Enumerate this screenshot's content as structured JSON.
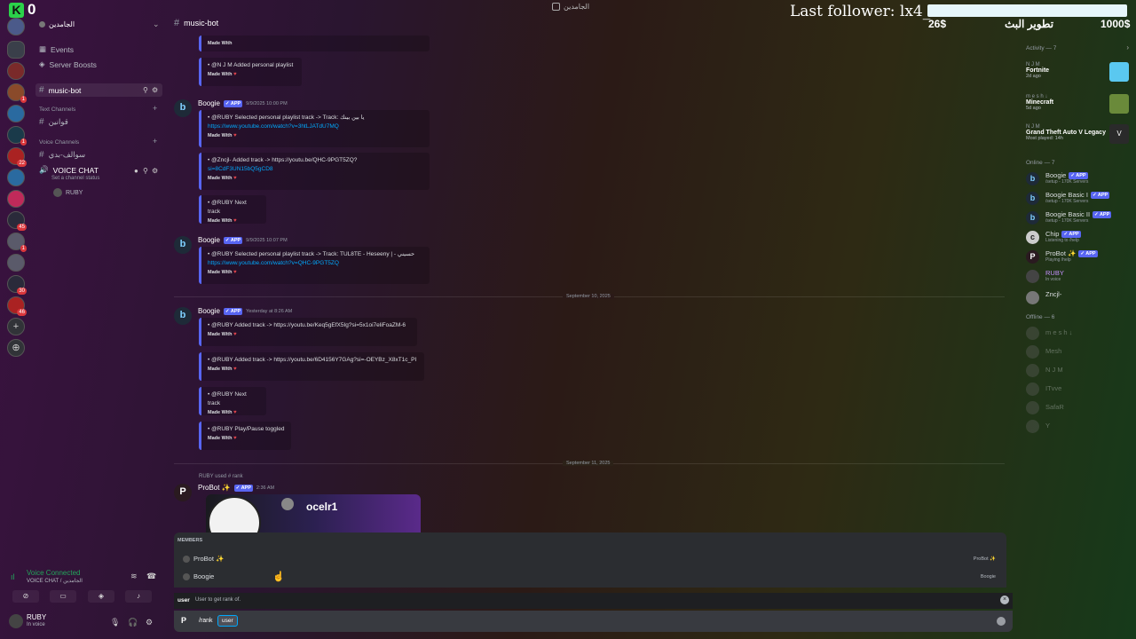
{
  "overlay": {
    "counter": "0",
    "window_title": "الجامدين",
    "last_follower": "Last follower: lx4_A",
    "goal_left": "26$",
    "goal_label": "تطوير البث",
    "goal_right": "1000$"
  },
  "server_rail": {
    "badges": [
      "1",
      "1",
      "22",
      "45",
      "1",
      "30",
      "1",
      "46"
    ]
  },
  "sidebar": {
    "guild_name": "الجامدين",
    "events": "Events",
    "server_boosts": "Server Boosts",
    "active_channel": "music-bot",
    "text_category": "Text Channels",
    "text_channel_1": "قوانين",
    "voice_category": "Voice Channels",
    "voice_channel_1": "سوالف-بدي",
    "voice_channel_2": "VOICE CHAT",
    "voice_status": "Set a channel status",
    "voice_member": "RUBY"
  },
  "voice_panel": {
    "connected": "Voice Connected",
    "sub": "VOICE CHAT / الجامدين",
    "user": "RUBY",
    "user_status": "In voice"
  },
  "chat": {
    "channel": "music-bot",
    "messages": {
      "e0_line": "Made With",
      "e1_line": "• @N J M Added personal playlist",
      "made_with": "Made With",
      "m1_author": "Boogie",
      "m1_ts": "9/9/2025 10:00 PM",
      "m1_e1_a": "• @RUBY Selected personal playlist track -> Track: يا بين بينك",
      "m1_e1_b": "https://www.youtube.com/watch?v=3htLJATdU7MQ",
      "m1_e2_a": "• @Zncjl- Added track -> https://youtu.be/QHC-9PGT5ZQ?",
      "m1_e2_b": "si=8CdF3UN15bQ5gCD8",
      "m1_e3": "• @RUBY Next track",
      "m2_author": "Boogie",
      "m2_ts": "9/9/2025 10:07 PM",
      "m2_e1_a": "• @RUBY Selected personal playlist track -> Track: TUL8TE - Heseeny | - حسيني",
      "m2_e1_b": "https://www.youtube.com/watch?v=QHC-9PGT5ZQ",
      "date1": "September 10, 2025",
      "m3_author": "Boogie",
      "m3_ts": "Yesterday at 8:26 AM",
      "m3_e1": "• @RUBY Added track -> https://youtu.be/Keq5gEfX5Ig?si=5x1oi7eliFoaZM-6",
      "m3_e2": "• @RUBY Added track -> https://youtu.be/6D4156Y7GAg?si=-OEYBz_X8xT1c_PI",
      "m3_e3": "• @RUBY Next track",
      "m3_e4": "• @RUBY Play/Pause toggled",
      "date2": "September 11, 2025",
      "m4_reply": "RUBY used # rank",
      "m4_author": "ProBot ✨",
      "m4_ts": "2:36 AM",
      "rank_name": "ocelr1"
    },
    "app_tag": "✓ APP"
  },
  "autocomplete": {
    "title": "MEMBERS",
    "items": [
      {
        "name": "ProBot ✨",
        "right": "ProBot ✨"
      },
      {
        "name": "Boogie",
        "right": "Boogie"
      }
    ],
    "option_key": "user",
    "option_desc": "User to get rank of.",
    "command": "/rank",
    "option_chip": "user"
  },
  "right_panel": {
    "activity_title": "Activity — 7",
    "activities": [
      {
        "who": "N J M",
        "game": "Fortnite",
        "sub": "2d ago"
      },
      {
        "who": "m e s h ↓",
        "game": "Minecraft",
        "sub": "5d ago"
      },
      {
        "who": "N J M",
        "game": "Grand Theft Auto V Legacy",
        "sub": "Most played: 14h"
      }
    ],
    "online_title": "Online — 7",
    "online": [
      {
        "name": "Boogie",
        "status": "/setup - 170K Servers",
        "app": true
      },
      {
        "name": "Boogie Basic I",
        "status": "/setup - 170K Servers",
        "app": true
      },
      {
        "name": "Boogie Basic II",
        "status": "/setup - 170K Servers",
        "app": true
      },
      {
        "name": "Chip",
        "status": "Listening to /help",
        "app": true
      },
      {
        "name": "ProBot ✨",
        "status": "Playing /help",
        "app": true
      },
      {
        "name": "RUBY",
        "status": "In voice",
        "app": false
      },
      {
        "name": "Zncjl-",
        "status": "",
        "app": false
      }
    ],
    "offline_title": "Offline — 6",
    "offline": [
      "m e s h ↓",
      "Mesh",
      "N J M",
      "ITvve",
      "SafaR",
      "Y"
    ],
    "colors": {
      "accent": "#5865f2",
      "online": "#23a55a",
      "link": "#00a8fc"
    }
  }
}
